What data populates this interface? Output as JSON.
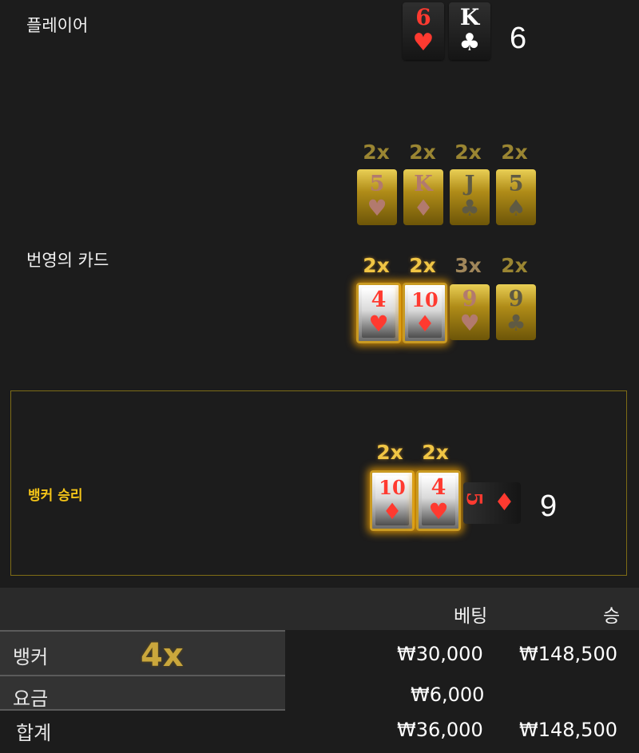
{
  "player": {
    "label": "플레이어",
    "cards": [
      {
        "rank": "6",
        "suit": "♥",
        "color": "red"
      },
      {
        "rank": "K",
        "suit": "♣",
        "color": "white"
      }
    ],
    "score": "6"
  },
  "lightning": {
    "label": "번영의 카드",
    "row1": [
      {
        "mult": "2x",
        "rank": "5",
        "suit": "♥",
        "tone": "pinkish"
      },
      {
        "mult": "2x",
        "rank": "K",
        "suit": "♦",
        "tone": "pinkish"
      },
      {
        "mult": "2x",
        "rank": "J",
        "suit": "♣",
        "tone": "grey"
      },
      {
        "mult": "2x",
        "rank": "5",
        "suit": "♠",
        "tone": "grey"
      }
    ],
    "row2": [
      {
        "mult": "2x",
        "rank": "4",
        "suit": "♥",
        "tone": "hot"
      },
      {
        "mult": "2x",
        "rank": "10",
        "suit": "♦",
        "tone": "hot"
      },
      {
        "mult": "3x",
        "rank": "9",
        "suit": "♥",
        "tone": "pinkish"
      },
      {
        "mult": "2x",
        "rank": "9",
        "suit": "♣",
        "tone": "grey"
      }
    ]
  },
  "banker": {
    "result_label": "뱅커 승리",
    "cards": [
      {
        "mult": "2x",
        "rank": "10",
        "suit": "♦"
      },
      {
        "mult": "2x",
        "rank": "4",
        "suit": "♥"
      }
    ],
    "third_card": {
      "rank": "5",
      "suit": "♦"
    },
    "score": "9"
  },
  "table": {
    "headers": {
      "bet": "베팅",
      "win": "승"
    },
    "rows": [
      {
        "label": "뱅커",
        "multiplier": "4x",
        "bet": "₩30,000",
        "win": "₩148,500"
      },
      {
        "label": "요금",
        "bet": "₩6,000",
        "win": ""
      },
      {
        "label": "합계",
        "bet": "₩36,000",
        "win": "₩148,500"
      }
    ]
  }
}
